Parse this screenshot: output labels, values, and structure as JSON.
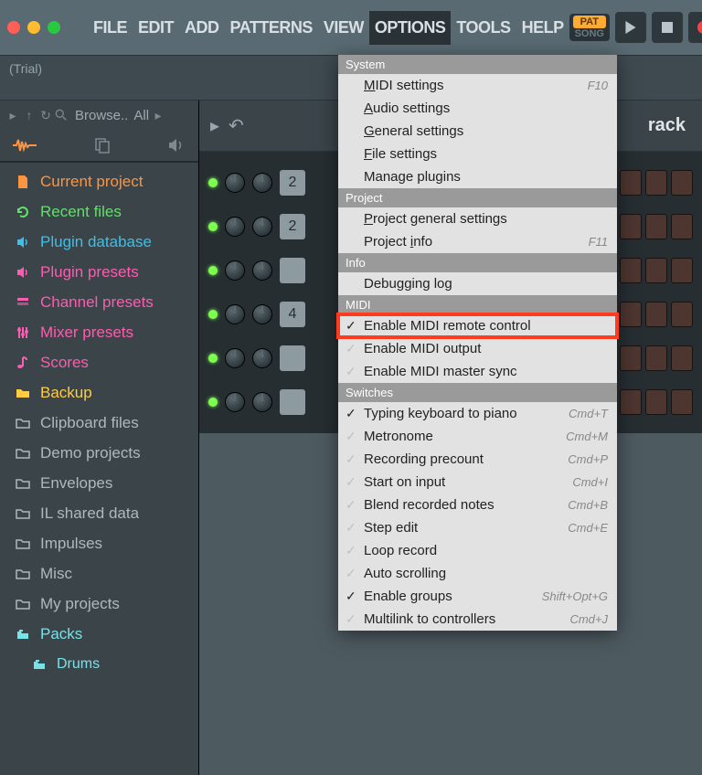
{
  "menubar": {
    "items": [
      "FILE",
      "EDIT",
      "ADD",
      "PATTERNS",
      "VIEW",
      "OPTIONS",
      "TOOLS",
      "HELP"
    ],
    "active_index": 5
  },
  "transport": {
    "pat_label": "PAT",
    "song_label": "SONG"
  },
  "status": {
    "text": "(Trial)"
  },
  "browser": {
    "title": "Browse..",
    "filter": "All",
    "items": [
      {
        "label": "Current project",
        "color": "#ff9440",
        "icon": "doc"
      },
      {
        "label": "Recent files",
        "color": "#63e06a",
        "icon": "refresh"
      },
      {
        "label": "Plugin database",
        "color": "#3fbfe8",
        "icon": "speaker"
      },
      {
        "label": "Plugin presets",
        "color": "#ff5bb0",
        "icon": "speaker"
      },
      {
        "label": "Channel presets",
        "color": "#ff5bb0",
        "icon": "layers"
      },
      {
        "label": "Mixer presets",
        "color": "#ff5bb0",
        "icon": "sliders"
      },
      {
        "label": "Scores",
        "color": "#ff5bb0",
        "icon": "note"
      },
      {
        "label": "Backup",
        "color": "#ffcc44",
        "icon": "folder"
      },
      {
        "label": "Clipboard files",
        "color": "#aeb9bd",
        "icon": "folder-o"
      },
      {
        "label": "Demo projects",
        "color": "#aeb9bd",
        "icon": "folder-o"
      },
      {
        "label": "Envelopes",
        "color": "#aeb9bd",
        "icon": "folder-o"
      },
      {
        "label": "IL shared data",
        "color": "#aeb9bd",
        "icon": "folder-o"
      },
      {
        "label": "Impulses",
        "color": "#aeb9bd",
        "icon": "folder-o"
      },
      {
        "label": "Misc",
        "color": "#aeb9bd",
        "icon": "folder-o"
      },
      {
        "label": "My projects",
        "color": "#aeb9bd",
        "icon": "folder-o"
      },
      {
        "label": "Packs",
        "color": "#77e2e8",
        "icon": "packs"
      },
      {
        "label": "Drums",
        "color": "#77e2e8",
        "icon": "packs",
        "sub": true
      }
    ]
  },
  "content": {
    "track_label": "rack",
    "channels": [
      {
        "num": "2"
      },
      {
        "num": "2"
      },
      {
        "num": ""
      },
      {
        "num": "4"
      },
      {
        "num": ""
      },
      {
        "num": ""
      }
    ]
  },
  "dropdown": {
    "sections": [
      {
        "header": "System",
        "items": [
          {
            "label": "MIDI settings",
            "u": 0,
            "shortcut": "F10"
          },
          {
            "label": "Audio settings",
            "u": 0
          },
          {
            "label": "General settings",
            "u": 0
          },
          {
            "label": "File settings",
            "u": 0
          },
          {
            "label": "Manage plugins"
          }
        ]
      },
      {
        "header": "Project",
        "items": [
          {
            "label": "Project general settings",
            "u": 0
          },
          {
            "label": "Project info",
            "u": 8,
            "shortcut": "F11"
          }
        ]
      },
      {
        "header": "Info",
        "items": [
          {
            "label": "Debugging log"
          }
        ]
      },
      {
        "header": "MIDI",
        "items": [
          {
            "label": "Enable MIDI remote control",
            "check": true,
            "highlighted": true
          },
          {
            "label": "Enable MIDI output",
            "check": false
          },
          {
            "label": "Enable MIDI master sync",
            "check": false
          }
        ]
      },
      {
        "header": "Switches",
        "items": [
          {
            "label": "Typing keyboard to piano",
            "check": true,
            "shortcut": "Cmd+T"
          },
          {
            "label": "Metronome",
            "check": false,
            "shortcut": "Cmd+M"
          },
          {
            "label": "Recording precount",
            "check": false,
            "shortcut": "Cmd+P"
          },
          {
            "label": "Start on input",
            "check": false,
            "shortcut": "Cmd+I"
          },
          {
            "label": "Blend recorded notes",
            "check": false,
            "shortcut": "Cmd+B"
          },
          {
            "label": "Step edit",
            "check": false,
            "shortcut": "Cmd+E"
          },
          {
            "label": "Loop record",
            "check": false
          },
          {
            "label": "Auto scrolling",
            "check": false
          },
          {
            "label": "Enable groups",
            "check": true,
            "shortcut": "Shift+Opt+G"
          },
          {
            "label": "Multilink to controllers",
            "check": false,
            "shortcut": "Cmd+J"
          }
        ]
      }
    ]
  }
}
